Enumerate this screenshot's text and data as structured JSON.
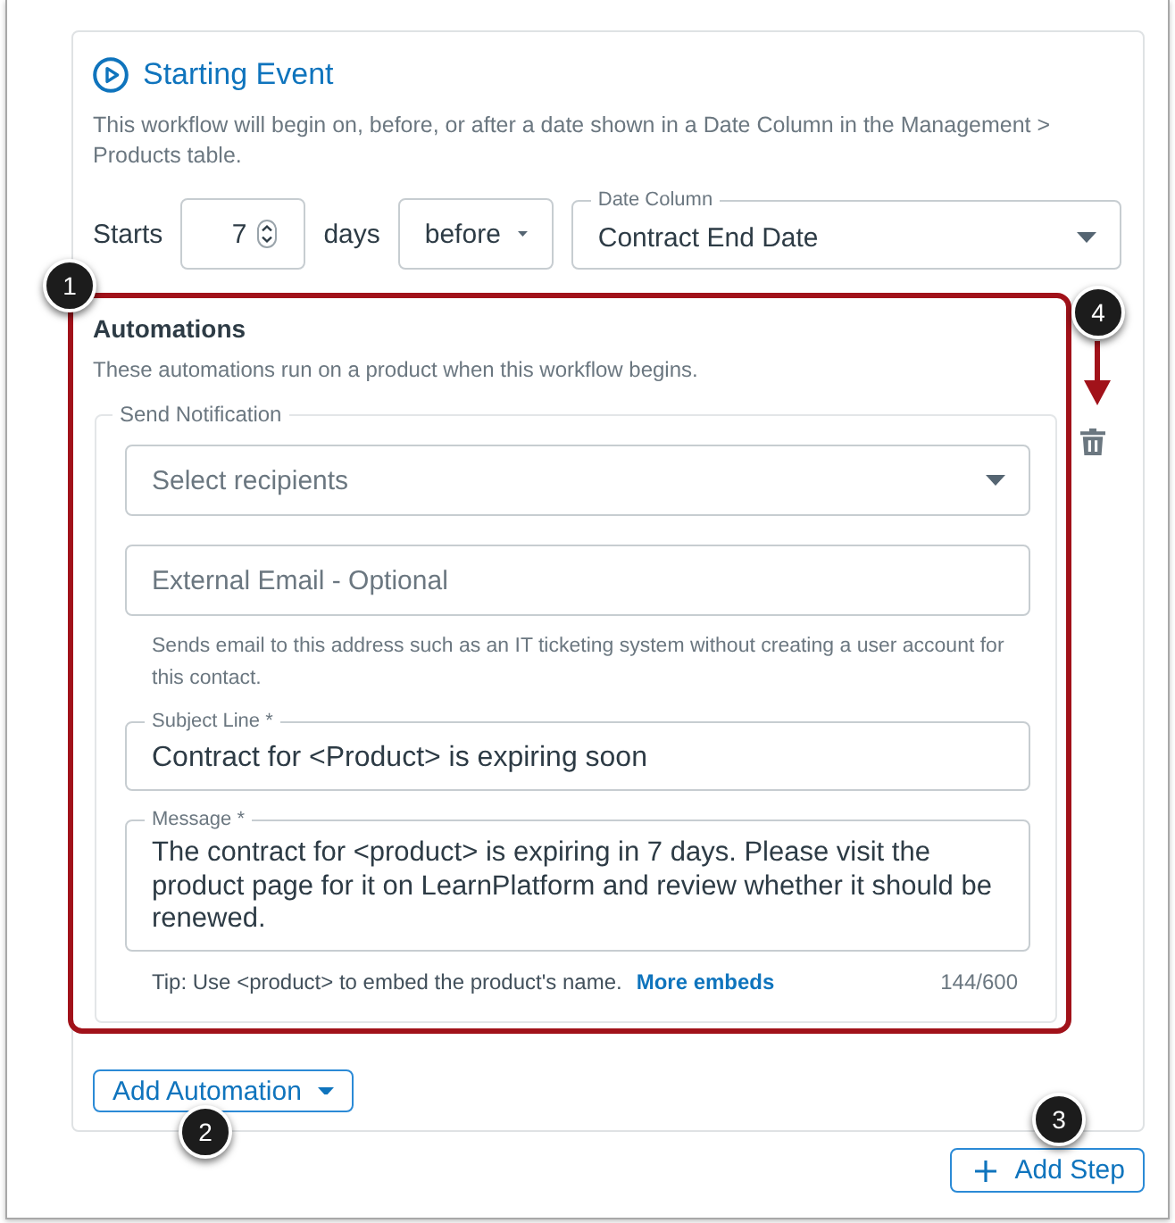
{
  "starting_event": {
    "title": "Starting Event",
    "description": "This workflow will begin on, before, or after a date shown in a Date Column in the Management > Products table.",
    "starts_label": "Starts",
    "days_input": {
      "value": "7"
    },
    "days_label": "days",
    "timing_select": {
      "value": "before"
    },
    "date_column_select": {
      "label": "Date Column",
      "value": "Contract End Date"
    }
  },
  "automations": {
    "highlighted": true,
    "title": "Automations",
    "description": "These automations run on a product when this workflow begins.",
    "notification": {
      "legend": "Send Notification",
      "recipients_select": {
        "placeholder": "Select recipients"
      },
      "external_email": {
        "placeholder": "External Email - Optional",
        "hint": "Sends email to this address such as an IT ticketing system without creating a user account for this contact."
      },
      "subject_line": {
        "label": "Subject Line *",
        "value": "Contract for <Product> is expiring soon"
      },
      "message": {
        "label": "Message *",
        "value": "The contract for <product> is expiring in 7 days. Please visit the product page for it on LearnPlatform and review whether it should be renewed."
      },
      "tip": "Tip: Use <product> to embed the product's name.",
      "tip_link": "More embeds",
      "counter": "144/600"
    }
  },
  "add_automation_button": {
    "label": "Add Automation"
  },
  "add_step_button": {
    "label": "Add Step"
  },
  "callouts": [
    {
      "number": "1"
    },
    {
      "number": "2"
    },
    {
      "number": "3"
    },
    {
      "number": "4"
    }
  ]
}
